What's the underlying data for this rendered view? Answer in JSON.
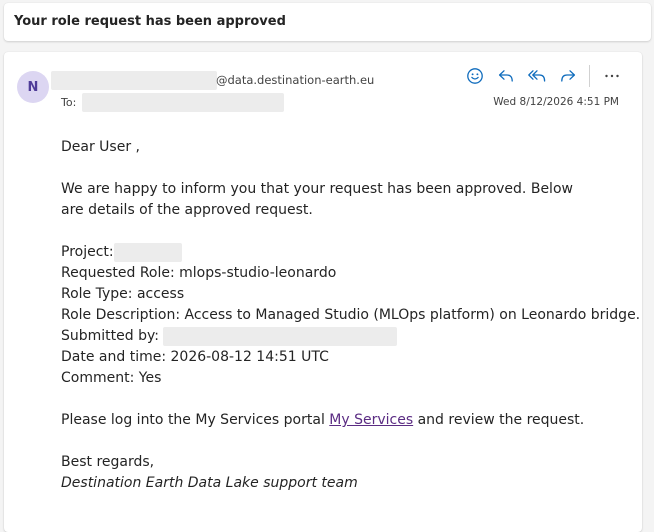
{
  "subject": "Your role request has been approved",
  "header": {
    "avatar_letter": "N",
    "from_domain": "@data.destination-earth.eu",
    "to_label": "To:",
    "timestamp": "Wed 8/12/2026 4:51 PM",
    "actions": [
      "smile-icon",
      "reply-icon",
      "reply-all-icon",
      "forward-icon",
      "more-icon"
    ],
    "accent_color": "#0f6cbd"
  },
  "body": {
    "greeting": "Dear User ,",
    "intro": "We are happy to inform you that your request has been approved. Below are details of the approved request.",
    "project_label": "Project:",
    "requested_role": "Requested Role: mlops-studio-leonardo",
    "role_type": "Role Type: access",
    "role_description": "Role Description: Access to Managed Studio (MLOps platform) on Leonardo bridge.",
    "submitted_by_label": "Submitted by:",
    "date_time": "Date and time: 2026-08-12 14:51 UTC",
    "comment": "Comment: Yes",
    "portal_prefix": "Please log into the My Services portal ",
    "portal_link": "My Services",
    "portal_suffix": " and review the request.",
    "closing": "Best regards,",
    "signature": "Destination Earth Data Lake support team"
  }
}
